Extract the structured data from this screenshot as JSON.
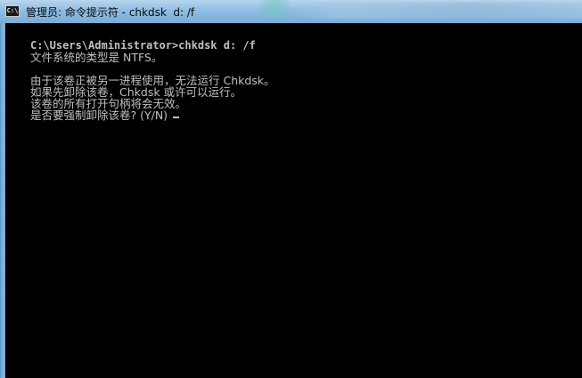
{
  "window": {
    "title": "管理员: 命令提示符 - chkdsk  d: /f",
    "icon": "console-icon",
    "icon_glyph": "C:\\"
  },
  "console": {
    "lines": [
      "C:\\Users\\Administrator>chkdsk d: /f",
      "文件系统的类型是 NTFS。",
      "",
      "由于该卷正被另一进程使用，无法运行 Chkdsk。",
      "如果先卸除该卷，Chkdsk 或许可以运行。",
      "该卷的所有打开句柄将会无效。",
      "是否要强制卸除该卷? (Y/N) "
    ],
    "text_color": "#c0c0c0",
    "background_color": "#000000"
  }
}
